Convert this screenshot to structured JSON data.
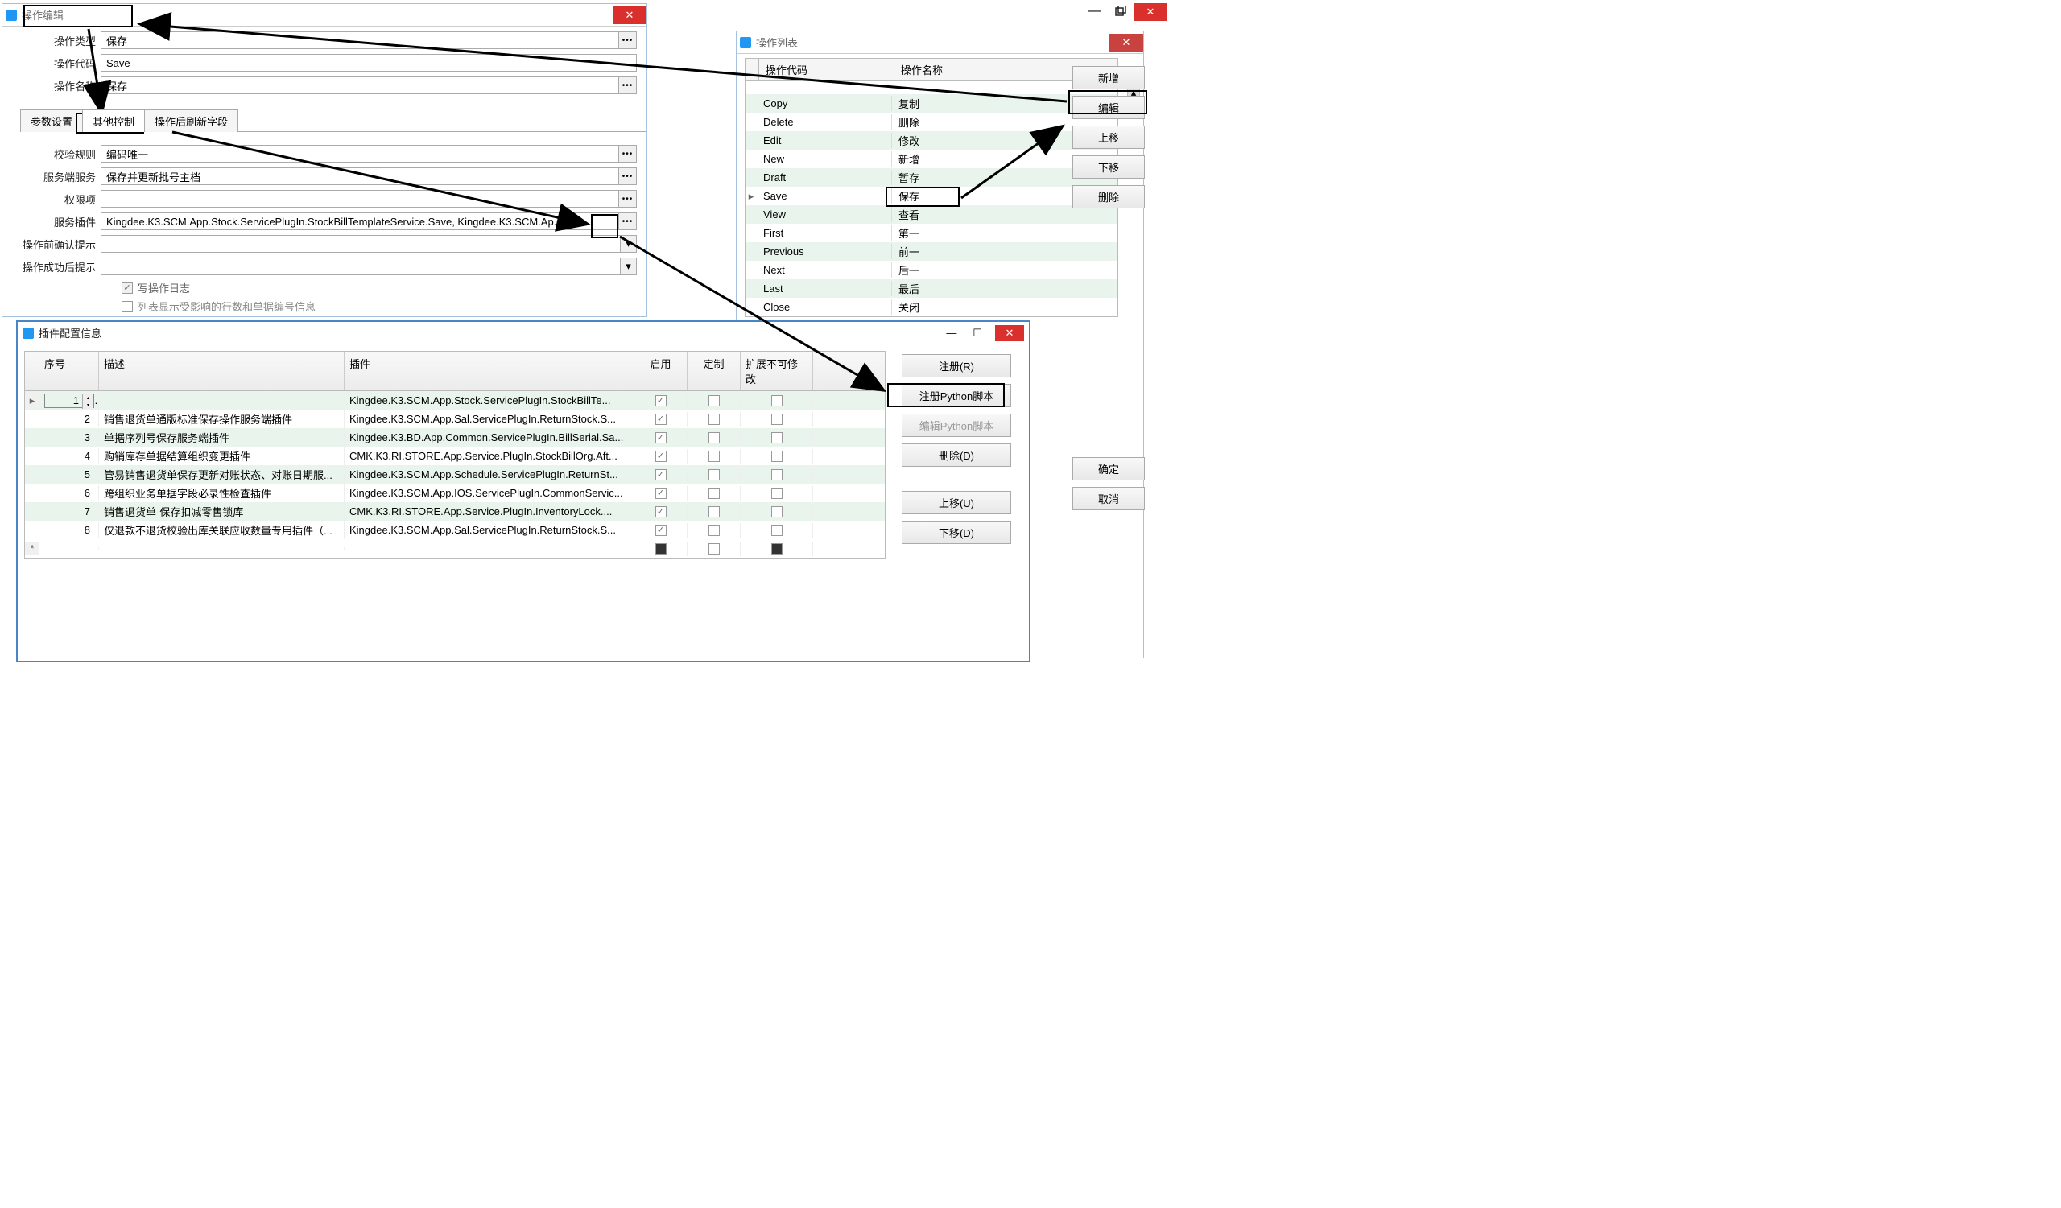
{
  "main_window_controls": {
    "minimize": "—",
    "close": "✕"
  },
  "edit_dialog": {
    "title": "操作编辑",
    "fields": {
      "type_label": "操作类型",
      "type_value": "保存",
      "code_label": "操作代码",
      "code_value": "Save",
      "name_label": "操作名称",
      "name_value": "保存"
    },
    "tabs": {
      "params": "参数设置",
      "other": "其他控制",
      "refresh": "操作后刷新字段"
    },
    "controls": {
      "validate_label": "校验规则",
      "validate_value": "编码唯一",
      "server_service_label": "服务端服务",
      "server_service_value": "保存并更新批号主档",
      "permission_label": "权限项",
      "permission_value": "",
      "plugin_label": "服务插件",
      "plugin_value": "Kingdee.K3.SCM.App.Stock.ServicePlugIn.StockBillTemplateService.Save, Kingdee.K3.SCM.Ap...",
      "pre_confirm_label": "操作前确认提示",
      "pre_confirm_value": "",
      "success_label": "操作成功后提示",
      "success_value": "",
      "log_label": "写操作日志",
      "extra_label": "列表显示受影响的行数和单据编号信息"
    }
  },
  "list_panel": {
    "title": "操作列表",
    "col_code": "操作代码",
    "col_name": "操作名称",
    "rows": [
      {
        "code": "Copy",
        "name": "复制"
      },
      {
        "code": "Delete",
        "name": "删除"
      },
      {
        "code": "Edit",
        "name": "修改"
      },
      {
        "code": "New",
        "name": "新增"
      },
      {
        "code": "Draft",
        "name": "暂存"
      },
      {
        "code": "Save",
        "name": "保存"
      },
      {
        "code": "View",
        "name": "查看"
      },
      {
        "code": "First",
        "name": "第一"
      },
      {
        "code": "Previous",
        "name": "前一"
      },
      {
        "code": "Next",
        "name": "后一"
      },
      {
        "code": "Last",
        "name": "最后"
      },
      {
        "code": "Close",
        "name": "关闭"
      }
    ],
    "buttons": {
      "add": "新增",
      "edit": "编辑",
      "up": "上移",
      "down": "下移",
      "delete": "删除"
    },
    "bottom_buttons": {
      "ok": "确定",
      "cancel": "取消"
    }
  },
  "plugin_dialog": {
    "title": "插件配置信息",
    "columns": {
      "seq": "序号",
      "desc": "描述",
      "plugin": "插件",
      "enable": "启用",
      "custom": "定制",
      "ext": "扩展不可修改"
    },
    "rows": [
      {
        "seq": "1",
        "desc": "",
        "plugin": "Kingdee.K3.SCM.App.Stock.ServicePlugIn.StockBillTe...",
        "enable": true,
        "custom": false,
        "ext": false
      },
      {
        "seq": "2",
        "desc": "销售退货单通版标准保存操作服务端插件",
        "plugin": "Kingdee.K3.SCM.App.Sal.ServicePlugIn.ReturnStock.S...",
        "enable": true,
        "custom": false,
        "ext": false
      },
      {
        "seq": "3",
        "desc": "单据序列号保存服务端插件",
        "plugin": "Kingdee.K3.BD.App.Common.ServicePlugIn.BillSerial.Sa...",
        "enable": true,
        "custom": false,
        "ext": false
      },
      {
        "seq": "4",
        "desc": "购销库存单据结算组织变更插件",
        "plugin": "CMK.K3.RI.STORE.App.Service.PlugIn.StockBillOrg.Aft...",
        "enable": true,
        "custom": false,
        "ext": false
      },
      {
        "seq": "5",
        "desc": "管易销售退货单保存更新对账状态、对账日期服...",
        "plugin": "Kingdee.K3.SCM.App.Schedule.ServicePlugIn.ReturnSt...",
        "enable": true,
        "custom": false,
        "ext": false
      },
      {
        "seq": "6",
        "desc": "跨组织业务单据字段必录性检查插件",
        "plugin": "Kingdee.K3.SCM.App.IOS.ServicePlugIn.CommonServic...",
        "enable": true,
        "custom": false,
        "ext": false
      },
      {
        "seq": "7",
        "desc": "销售退货单-保存扣减零售锁库",
        "plugin": "CMK.K3.RI.STORE.App.Service.PlugIn.InventoryLock....",
        "enable": true,
        "custom": false,
        "ext": false
      },
      {
        "seq": "8",
        "desc": "仅退款不退货校验出库关联应收数量专用插件（...",
        "plugin": "Kingdee.K3.SCM.App.Sal.ServicePlugIn.ReturnStock.S...",
        "enable": true,
        "custom": false,
        "ext": false
      }
    ],
    "buttons": {
      "register": "注册(R)",
      "register_py": "注册Python脚本",
      "edit_py": "编辑Python脚本",
      "delete": "删除(D)",
      "up": "上移(U)",
      "down": "下移(D)"
    }
  }
}
